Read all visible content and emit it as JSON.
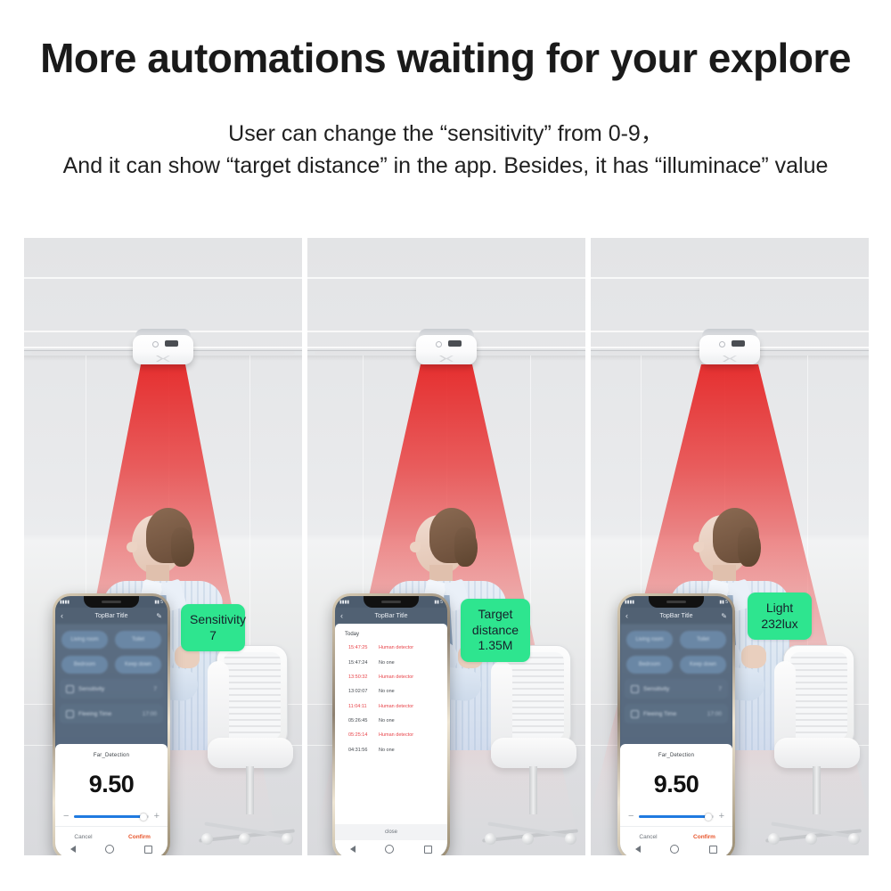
{
  "headline": "More automations waiting for your explore",
  "subtitle_line1": "User can change the “sensitivity” from 0-9，",
  "subtitle_line2": "And it can show “target distance” in the app. Besides, it has “illuminace” value",
  "colors": {
    "badge_green": "#2ee58f",
    "cone_red": "#e52020",
    "confirm_orange": "#e8542a",
    "slider_blue": "#1f7ae0",
    "alert_red": "#e8444a"
  },
  "badges": [
    {
      "title": "Sensitivity",
      "value": "7"
    },
    {
      "title": "Target\ndistance",
      "line1": "Target",
      "line2": "distance",
      "value": "1.35M"
    },
    {
      "title": "Light",
      "value": "232lux"
    }
  ],
  "panels": [
    {
      "name": "sensitivity-panel",
      "badge_label": "Sensitivity",
      "badge_value": "7",
      "phone": "settings"
    },
    {
      "name": "target-distance-panel",
      "badge_label_line1": "Target",
      "badge_label_line2": "distance",
      "badge_value": "1.35M",
      "phone": "log"
    },
    {
      "name": "illuminance-panel",
      "badge_label": "Light",
      "badge_value": "232lux",
      "phone": "settings"
    }
  ],
  "phone_settings": {
    "statusbar_left": "▮▮▮▮",
    "statusbar_right": "▮▮ 5",
    "topbar_title": "TopBar Title",
    "back_icon": "‹",
    "edit_icon": "✎",
    "pills": [
      "Living room",
      "Toilet",
      "Bedroom",
      "Keep down"
    ],
    "rows": [
      {
        "label": "Sensitivity",
        "value": "7"
      },
      {
        "label": "Fleeing Time",
        "value": "17:00"
      }
    ],
    "sheet_title": "Far_Detection",
    "sheet_value": "9.50",
    "slider_minus": "−",
    "slider_plus": "+",
    "slider_percent": 93,
    "cancel_label": "Cancel",
    "confirm_label": "Confirm"
  },
  "phone_log": {
    "statusbar_left": "▮▮▮▮",
    "statusbar_right": "▮▮ 5",
    "topbar_title": "TopBar Title",
    "back_icon": "‹",
    "today_label": "Today",
    "entries": [
      {
        "time": "15:47:25",
        "event": "Human detector",
        "state": "alert"
      },
      {
        "time": "15:47:24",
        "event": "No one",
        "state": "idle"
      },
      {
        "time": "13:50:32",
        "event": "Human detector",
        "state": "alert"
      },
      {
        "time": "13:02:07",
        "event": "No one",
        "state": "idle"
      },
      {
        "time": "11:04:11",
        "event": "Human detector",
        "state": "alert"
      },
      {
        "time": "05:26:45",
        "event": "No one",
        "state": "idle"
      },
      {
        "time": "05:25:14",
        "event": "Human detector",
        "state": "alert"
      },
      {
        "time": "04:31:56",
        "event": "No one",
        "state": "idle"
      }
    ],
    "close_label": "close"
  }
}
